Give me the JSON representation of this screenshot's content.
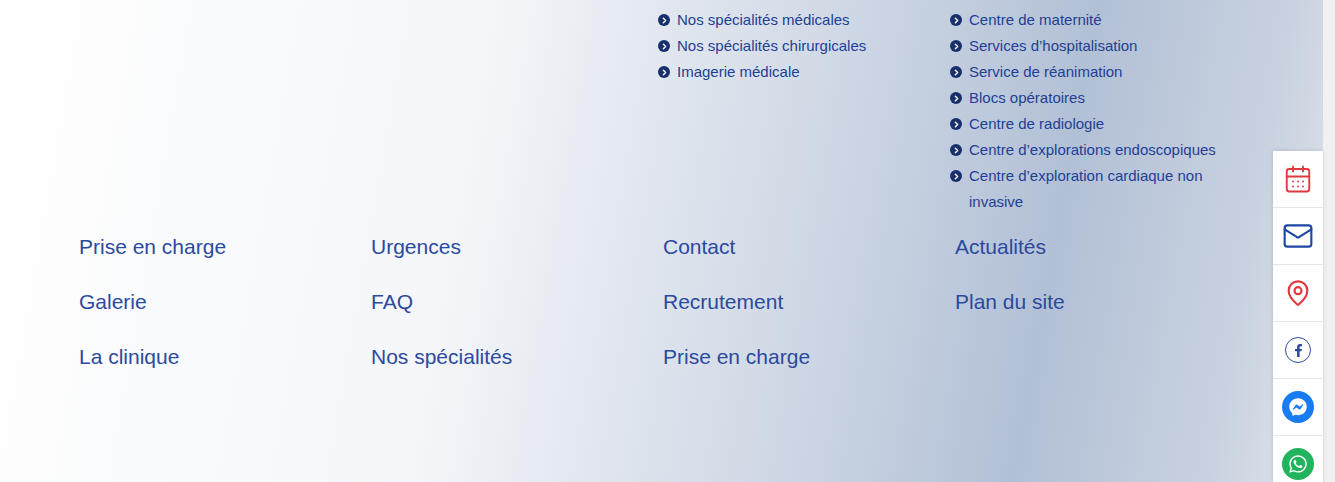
{
  "service_lists": [
    {
      "items": [
        "Nos spécialités médicales",
        "Nos spécialités chirurgicales",
        "Imagerie médicale"
      ]
    },
    {
      "items": [
        "Centre de maternité",
        "Services d’hospitalisation",
        "Service de réanimation",
        "Blocs opératoires",
        "Centre de radiologie",
        "Centre d’explorations endoscopiques",
        "Centre d’exploration cardiaque non invasive"
      ]
    }
  ],
  "footer_links": [
    [
      "Prise en charge",
      "Urgences",
      "Contact",
      "Actualités"
    ],
    [
      "Galerie",
      "FAQ",
      "Recrutement",
      "Plan du site"
    ],
    [
      "La clinique",
      "Nos spécialités",
      "Prise en charge"
    ]
  ],
  "side_bar": [
    {
      "kind": "calendar",
      "color": "#e0383e"
    },
    {
      "kind": "mail",
      "color": "#1c47a3"
    },
    {
      "kind": "pin",
      "color": "#e0383e"
    },
    {
      "kind": "facebook",
      "color": "#2d4a9c"
    },
    {
      "kind": "messenger",
      "color": "#1a7cf2"
    },
    {
      "kind": "whatsapp",
      "color": "#22b35e"
    }
  ]
}
